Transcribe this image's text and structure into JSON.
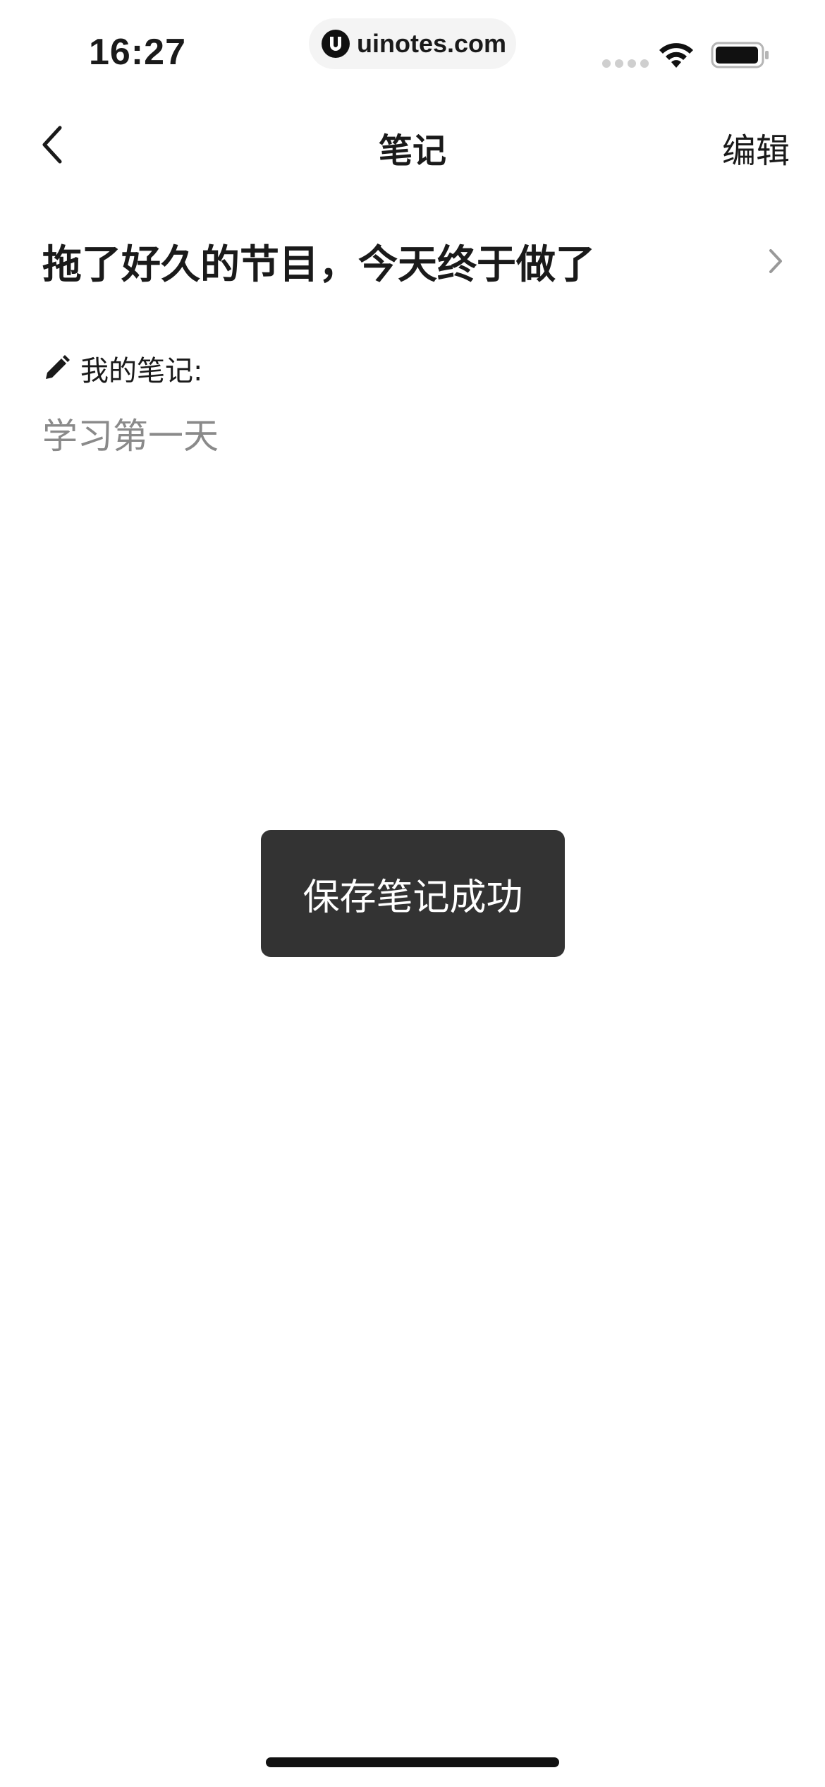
{
  "status_bar": {
    "time": "16:27",
    "url": "uinotes.com",
    "icons": [
      "signal-icon",
      "wifi-icon",
      "battery-icon"
    ]
  },
  "nav": {
    "title": "笔记",
    "edit_label": "编辑",
    "back_icon": "chevron-left-icon"
  },
  "program": {
    "title": "拖了好久的节目，今天终于做了",
    "icon": "chevron-right-icon"
  },
  "note": {
    "label": "我的笔记:",
    "icon": "pencil-icon",
    "content": "学习第一天"
  },
  "toast": {
    "message": "保存笔记成功"
  },
  "colors": {
    "background": "#ffffff",
    "text_primary": "#1a1a1a",
    "text_secondary": "#8a8a8a",
    "toast_bg": "#333333",
    "toast_text": "#ffffff"
  }
}
